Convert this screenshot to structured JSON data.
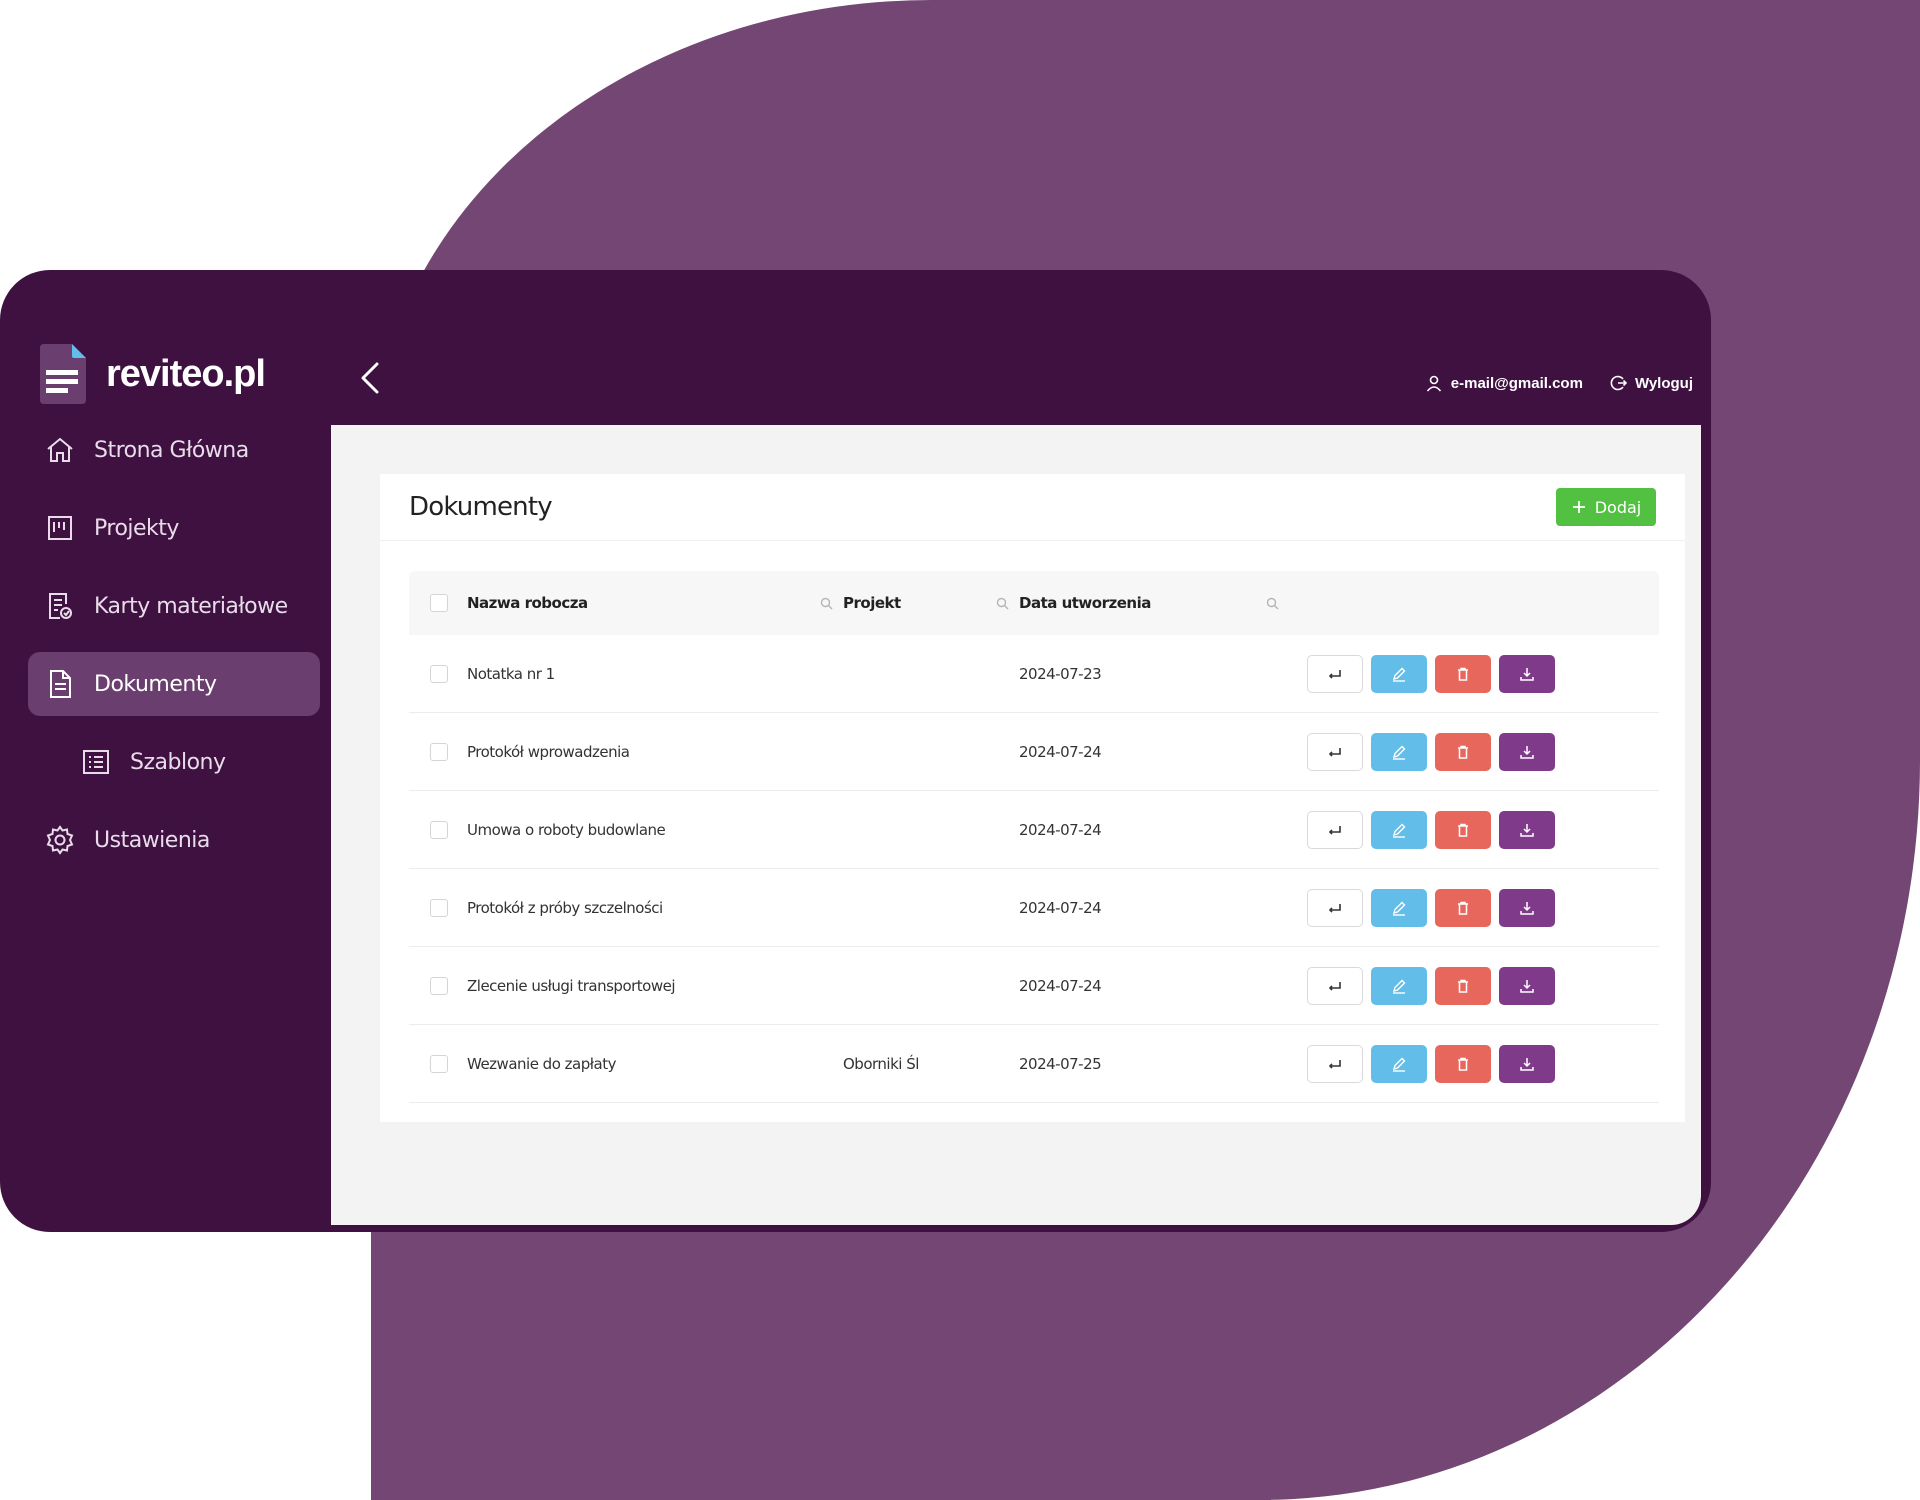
{
  "brand": {
    "name": "reviteo.pl"
  },
  "sidebar": {
    "items": [
      {
        "label": "Strona Główna",
        "icon": "home-icon",
        "active": false
      },
      {
        "label": "Projekty",
        "icon": "board-icon",
        "active": false
      },
      {
        "label": "Karty materiałowe",
        "icon": "material-card-icon",
        "active": false
      },
      {
        "label": "Dokumenty",
        "icon": "document-icon",
        "active": true
      },
      {
        "label": "Szablony",
        "icon": "template-list-icon",
        "active": false
      },
      {
        "label": "Ustawienia",
        "icon": "gear-icon",
        "active": false
      }
    ]
  },
  "topbar": {
    "user_email": "e-mail@gmail.com",
    "logout_label": "Wyloguj"
  },
  "page": {
    "title": "Dokumenty",
    "add_label": "Dodaj"
  },
  "table": {
    "columns": [
      "Nazwa robocza",
      "Projekt",
      "Data utworzenia"
    ],
    "rows": [
      {
        "name": "Notatka nr 1",
        "project": "",
        "date": "2024-07-23"
      },
      {
        "name": "Protokół wprowadzenia",
        "project": "",
        "date": "2024-07-24"
      },
      {
        "name": "Umowa o roboty budowlane",
        "project": "",
        "date": "2024-07-24"
      },
      {
        "name": "Protokół z próby szczelności",
        "project": "",
        "date": "2024-07-24"
      },
      {
        "name": "Zlecenie usługi transportowej",
        "project": "",
        "date": "2024-07-24"
      },
      {
        "name": "Wezwanie do zapłaty",
        "project": "Oborniki Śl",
        "date": "2024-07-25"
      }
    ]
  },
  "colors": {
    "window": "#3e1140",
    "accent_purple": "#803a8a",
    "add_green": "#52c041",
    "edit_blue": "#62bde9",
    "delete_red": "#e8675c",
    "backdrop": "#744673"
  }
}
